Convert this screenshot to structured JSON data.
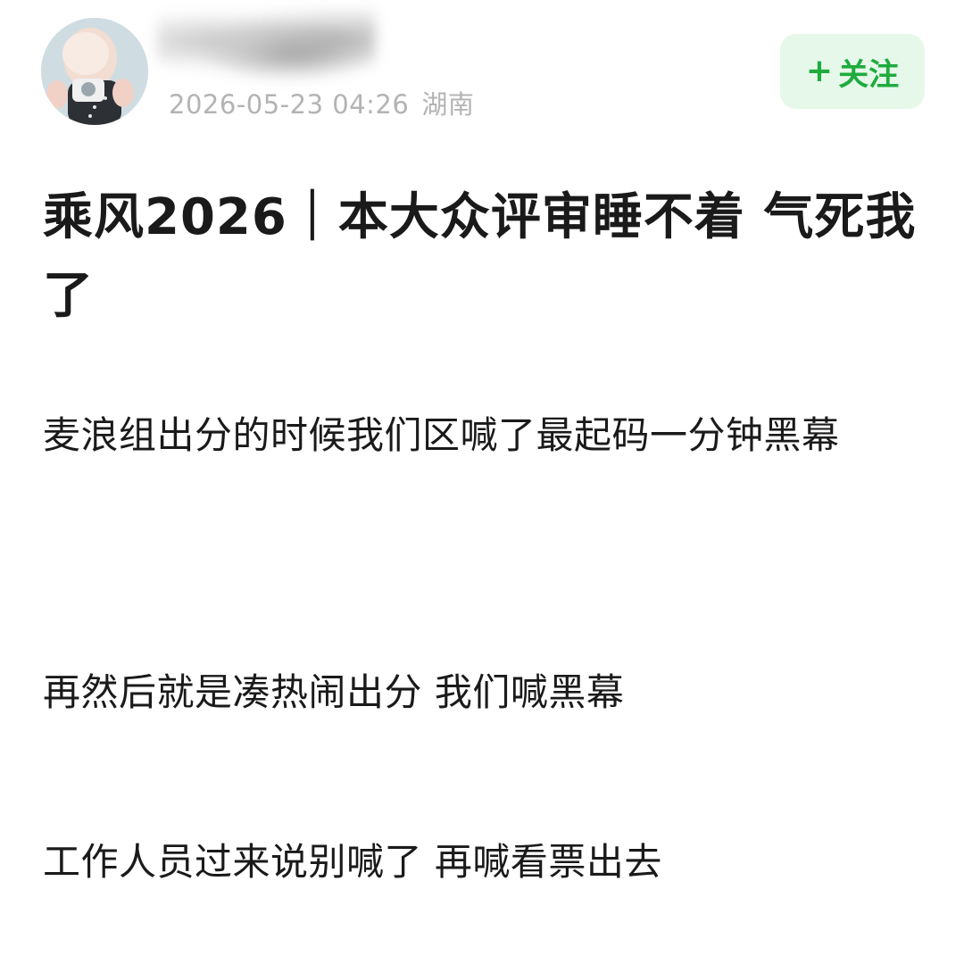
{
  "author": {
    "avatar_icon": "user-avatar-photo",
    "name": "",
    "timestamp": "2026-05-23 04:26",
    "location": "湖南"
  },
  "follow": {
    "icon": "plus-icon",
    "icon_glyph": "+",
    "label": "关注",
    "accent_color": "#1fab3e",
    "background_color": "#e6f8ea"
  },
  "post": {
    "title": "乘风2026｜本大众评审睡不着 气死我了",
    "paragraphs": [
      "麦浪组出分的时候我们区喊了最起码一分钟黑幕",
      "再然后就是凑热闹出分 我们喊黑幕",
      "工作人员过来说别喊了 再喊看票出去"
    ]
  }
}
